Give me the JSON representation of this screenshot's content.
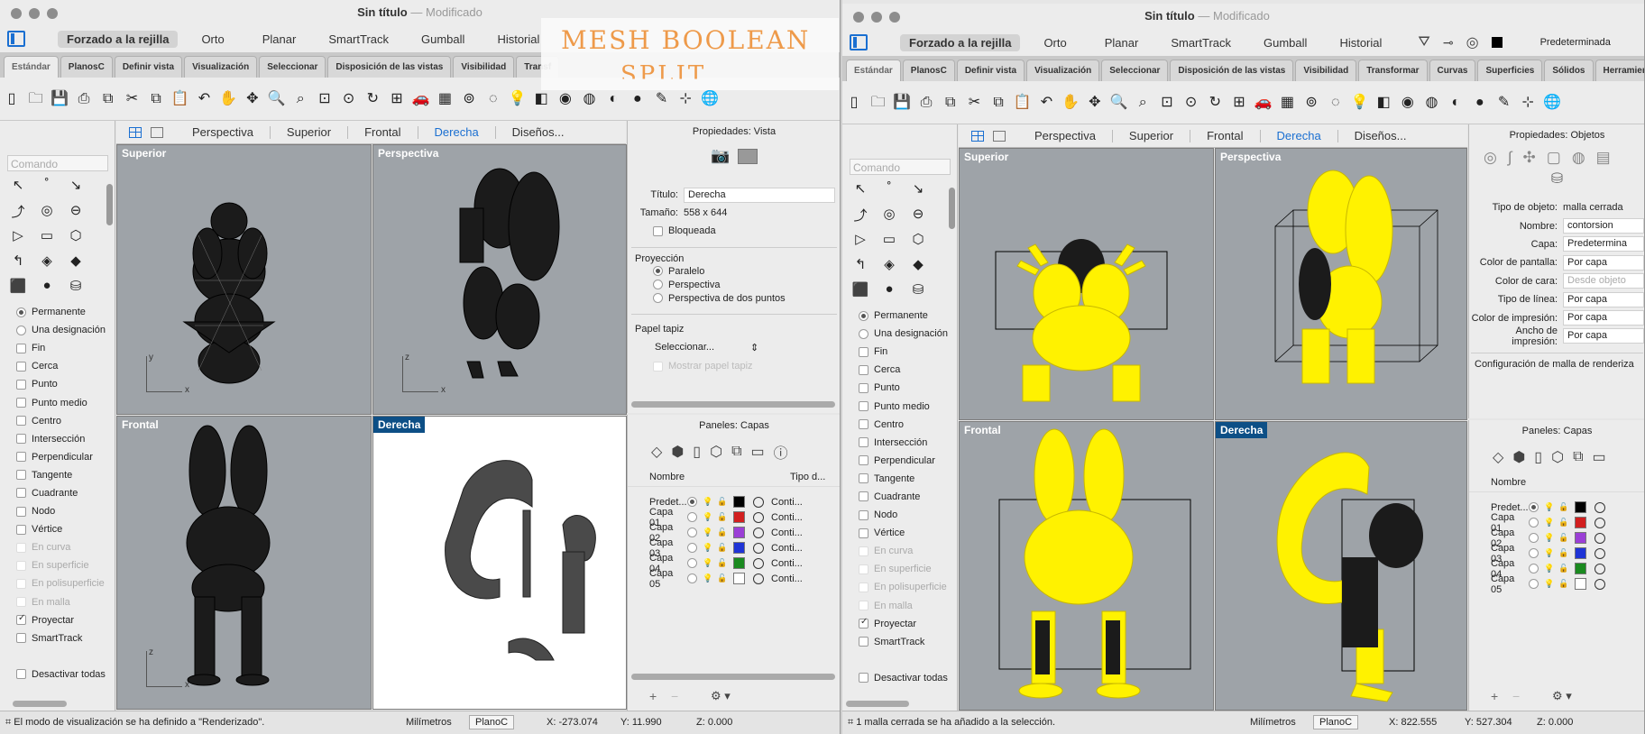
{
  "note": {
    "line1": "MESH BOOLEAN",
    "line2": "SPLIT"
  },
  "left": {
    "title": "Sin título",
    "title_mod": "— Modificado",
    "toolbar1": [
      "Forzado a la rejilla",
      "Orto",
      "Planar",
      "SmartTrack",
      "Gumball",
      "Historial"
    ],
    "tabs": [
      "Estándar",
      "PlanosC",
      "Definir vista",
      "Visualización",
      "Seleccionar",
      "Disposición de las vistas",
      "Visibilidad",
      "Transf"
    ],
    "viewport_tabs": [
      "Perspectiva",
      "Superior",
      "Frontal",
      "Derecha",
      "Diseños..."
    ],
    "command_placeholder": "Comando",
    "osnaps": [
      {
        "label": "Permanente",
        "kind": "radio",
        "on": true
      },
      {
        "label": "Una designación",
        "kind": "radio",
        "on": false
      },
      {
        "label": "Fin",
        "kind": "check",
        "on": false
      },
      {
        "label": "Cerca",
        "kind": "check",
        "on": false
      },
      {
        "label": "Punto",
        "kind": "check",
        "on": false
      },
      {
        "label": "Punto medio",
        "kind": "check",
        "on": false
      },
      {
        "label": "Centro",
        "kind": "check",
        "on": false
      },
      {
        "label": "Intersección",
        "kind": "check",
        "on": false
      },
      {
        "label": "Perpendicular",
        "kind": "check",
        "on": false
      },
      {
        "label": "Tangente",
        "kind": "check",
        "on": false
      },
      {
        "label": "Cuadrante",
        "kind": "check",
        "on": false
      },
      {
        "label": "Nodo",
        "kind": "check",
        "on": false
      },
      {
        "label": "Vértice",
        "kind": "check",
        "on": false
      },
      {
        "label": "En curva",
        "kind": "check",
        "on": false,
        "disabled": true
      },
      {
        "label": "En superficie",
        "kind": "check",
        "on": false,
        "disabled": true
      },
      {
        "label": "En polisuperficie",
        "kind": "check",
        "on": false,
        "disabled": true
      },
      {
        "label": "En malla",
        "kind": "check",
        "on": false,
        "disabled": true
      },
      {
        "label": "Proyectar",
        "kind": "check",
        "on": true
      },
      {
        "label": "SmartTrack",
        "kind": "check",
        "on": false
      },
      {
        "label": "",
        "kind": "spacer"
      },
      {
        "label": "Desactivar todas",
        "kind": "check",
        "on": false
      }
    ],
    "viewports": {
      "superior": "Superior",
      "perspectiva": "Perspectiva",
      "frontal": "Frontal",
      "derecha": "Derecha"
    },
    "props": {
      "header": "Propiedades: Vista",
      "titulo_label": "Título:",
      "titulo_value": "Derecha",
      "tamano_label": "Tamaño:",
      "tamano_value": "558 x 644",
      "bloqueada": "Bloqueada",
      "proyeccion": "Proyección",
      "paralelo": "Paralelo",
      "perspectiva": "Perspectiva",
      "dos_puntos": "Perspectiva de dos puntos",
      "papel": "Papel tapiz",
      "seleccionar": "Seleccionar...",
      "mostrar": "Mostrar papel tapiz"
    },
    "layers": {
      "header": "Paneles: Capas",
      "col_name": "Nombre",
      "col_type": "Tipo d...",
      "rows": [
        {
          "name": "Predet...",
          "color": "#000000",
          "type": "Conti..."
        },
        {
          "name": "Capa 01",
          "color": "#d21f1f",
          "type": "Conti..."
        },
        {
          "name": "Capa 02",
          "color": "#9b3fd6",
          "type": "Conti..."
        },
        {
          "name": "Capa 03",
          "color": "#1f34d6",
          "type": "Conti..."
        },
        {
          "name": "Capa 04",
          "color": "#1a8a1f",
          "type": "Conti..."
        },
        {
          "name": "Capa 05",
          "color": "#ffffff",
          "type": "Conti..."
        }
      ]
    },
    "status": {
      "message": "El modo de visualización se ha definido a \"Renderizado\".",
      "units": "Milímetros",
      "plane": "PlanoC",
      "x": "X: -273.074",
      "y": "Y: 11.990",
      "z": "Z: 0.000"
    }
  },
  "right": {
    "title": "Sin título",
    "title_mod": "— Modificado",
    "toolbar1": [
      "Forzado a la rejilla",
      "Orto",
      "Planar",
      "SmartTrack",
      "Gumball",
      "Historial"
    ],
    "layer_current": "Predeterminada",
    "tabs": [
      "Estándar",
      "PlanosC",
      "Definir vista",
      "Visualización",
      "Seleccionar",
      "Disposición de las vistas",
      "Visibilidad",
      "Transformar",
      "Curvas",
      "Superficies",
      "Sólidos",
      "Herramien"
    ],
    "viewport_tabs": [
      "Perspectiva",
      "Superior",
      "Frontal",
      "Derecha",
      "Diseños..."
    ],
    "command_placeholder": "Comando",
    "osnaps": [
      {
        "label": "Permanente",
        "kind": "radio",
        "on": true
      },
      {
        "label": "Una designación",
        "kind": "radio",
        "on": false
      },
      {
        "label": "Fin",
        "kind": "check",
        "on": false
      },
      {
        "label": "Cerca",
        "kind": "check",
        "on": false
      },
      {
        "label": "Punto",
        "kind": "check",
        "on": false
      },
      {
        "label": "Punto medio",
        "kind": "check",
        "on": false
      },
      {
        "label": "Centro",
        "kind": "check",
        "on": false
      },
      {
        "label": "Intersección",
        "kind": "check",
        "on": false
      },
      {
        "label": "Perpendicular",
        "kind": "check",
        "on": false
      },
      {
        "label": "Tangente",
        "kind": "check",
        "on": false
      },
      {
        "label": "Cuadrante",
        "kind": "check",
        "on": false
      },
      {
        "label": "Nodo",
        "kind": "check",
        "on": false
      },
      {
        "label": "Vértice",
        "kind": "check",
        "on": false
      },
      {
        "label": "En curva",
        "kind": "check",
        "on": false,
        "disabled": true
      },
      {
        "label": "En superficie",
        "kind": "check",
        "on": false,
        "disabled": true
      },
      {
        "label": "En polisuperficie",
        "kind": "check",
        "on": false,
        "disabled": true
      },
      {
        "label": "En malla",
        "kind": "check",
        "on": false,
        "disabled": true
      },
      {
        "label": "Proyectar",
        "kind": "check",
        "on": true
      },
      {
        "label": "SmartTrack",
        "kind": "check",
        "on": false
      },
      {
        "label": "",
        "kind": "spacer"
      },
      {
        "label": "Desactivar todas",
        "kind": "check",
        "on": false
      }
    ],
    "viewports": {
      "superior": "Superior",
      "perspectiva": "Perspectiva",
      "frontal": "Frontal",
      "derecha": "Derecha"
    },
    "props": {
      "header": "Propiedades: Objetos",
      "rows": [
        {
          "label": "Tipo de objeto:",
          "value": "malla cerrada",
          "plain": true
        },
        {
          "label": "Nombre:",
          "value": "contorsion"
        },
        {
          "label": "Capa:",
          "value": "Predetermina"
        },
        {
          "label": "Color de pantalla:",
          "value": "Por capa"
        },
        {
          "label": "Color de cara:",
          "value": "Desde objeto",
          "dim": true
        },
        {
          "label": "Tipo de línea:",
          "value": "Por capa"
        },
        {
          "label": "Color de impresión:",
          "value": "Por capa"
        },
        {
          "label": "Ancho de impresión:",
          "value": "Por capa"
        }
      ],
      "mesh_config": "Configuración de malla de renderiza"
    },
    "layers": {
      "header": "Paneles: Capas",
      "col_name": "Nombre",
      "rows": [
        {
          "name": "Predet...",
          "color": "#000000"
        },
        {
          "name": "Capa 01",
          "color": "#d21f1f"
        },
        {
          "name": "Capa 02",
          "color": "#9b3fd6"
        },
        {
          "name": "Capa 03",
          "color": "#1f34d6"
        },
        {
          "name": "Capa 04",
          "color": "#1a8a1f"
        },
        {
          "name": "Capa 05",
          "color": "#ffffff"
        }
      ]
    },
    "status": {
      "message": "1 malla cerrada se ha añadido a la selección.",
      "units": "Milímetros",
      "plane": "PlanoC",
      "x": "X: 822.555",
      "y": "Y: 527.304",
      "z": "Z: 0.000"
    }
  },
  "icons": [
    "new-file-icon",
    "open-folder-icon",
    "save-icon",
    "print-icon",
    "copy-icon",
    "cut-icon",
    "copy-icon",
    "paste-icon",
    "undo-icon",
    "pan-hand-icon",
    "move-view-icon",
    "zoom-icon",
    "zoom-window-icon",
    "zoom-extents-icon",
    "zoom-selected-icon",
    "rotate-view-icon",
    "four-viewports-icon",
    "car-icon",
    "grid-icon",
    "select-icon",
    "hide-icon",
    "lightbulb-icon",
    "layer-icon",
    "color-wheel-icon",
    "wireframe-sphere-icon",
    "shaded-sphere-icon",
    "rendered-sphere-icon",
    "pen-icon",
    "analyze-icon",
    "globe-icon"
  ],
  "colors": {
    "accent": "#1a6fd1",
    "viewport_bg": "#9ea3a8",
    "label_highlight": "#0d4f86",
    "mesh_yellow": "#fff200",
    "note_orange": "#ee9a4a"
  }
}
